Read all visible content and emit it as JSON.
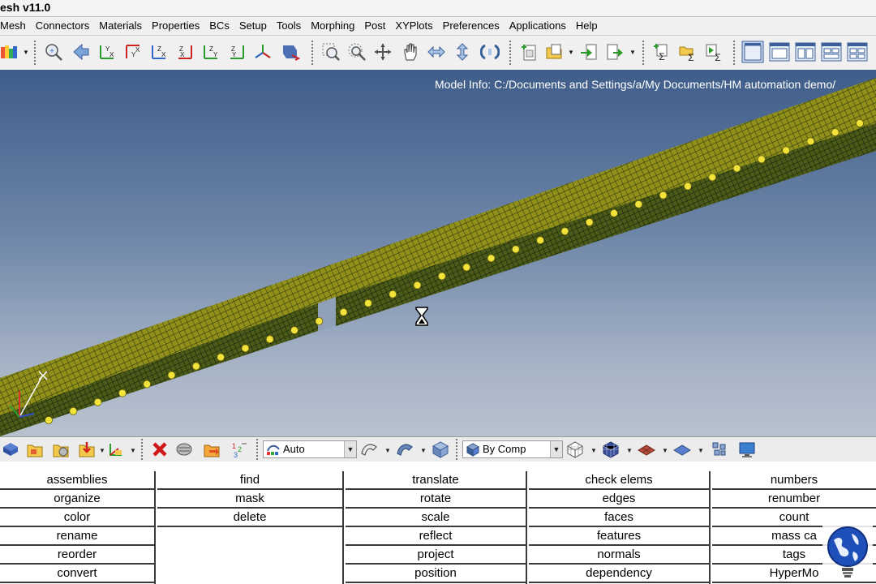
{
  "window": {
    "title": "esh v11.0"
  },
  "menu": [
    "Mesh",
    "Connectors",
    "Materials",
    "Properties",
    "BCs",
    "Setup",
    "Tools",
    "Morphing",
    "Post",
    "XYPlots",
    "Preferences",
    "Applications",
    "Help"
  ],
  "viewport": {
    "model_info": "Model Info: C:/Documents and Settings/a/My Documents/HM automation demo/"
  },
  "bottom_toolbar": {
    "display_mode": "Auto",
    "color_mode": "By Comp"
  },
  "panel": {
    "col1": [
      "assemblies",
      "organize",
      "color",
      "rename",
      "reorder",
      "convert"
    ],
    "col2": [
      "find",
      "mask",
      "delete"
    ],
    "col3": [
      "translate",
      "rotate",
      "scale",
      "reflect",
      "project",
      "position"
    ],
    "col4": [
      "check elems",
      "edges",
      "faces",
      "features",
      "normals",
      "dependency"
    ],
    "col5": [
      "numbers",
      "renumber",
      "count",
      "mass ca",
      "tags",
      "HyperMo"
    ]
  },
  "colors": {
    "mesh": "#8f8f1a",
    "mesh_lines": "#1d2a10",
    "weld_points": "#f2e33a",
    "viewport_top": "#3f5d8a",
    "viewport_bottom": "#b8c2cf"
  }
}
